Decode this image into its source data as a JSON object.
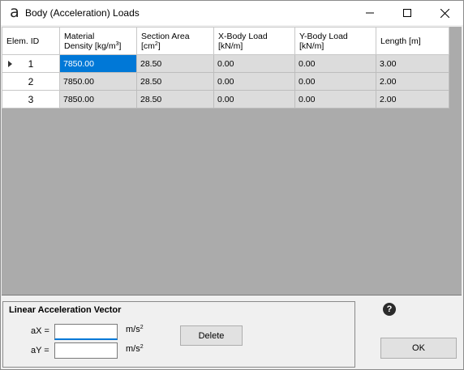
{
  "window": {
    "title": "Body (Acceleration) Loads",
    "icon": "app-logo-icon"
  },
  "grid": {
    "headers": {
      "elem_id": "Elem. ID",
      "density_1": "Material",
      "density_2": "Density [kg/m",
      "density_sup": "3",
      "density_end": "]",
      "area_1": "Section Area",
      "area_2": "[cm",
      "area_sup": "2",
      "area_end": "]",
      "xload_1": "X-Body Load",
      "xload_2": "[kN/m]",
      "yload_1": "Y-Body Load",
      "yload_2": "[kN/m]",
      "length": "Length [m]"
    },
    "rows": [
      {
        "id": "1",
        "density": "7850.00",
        "area": "28.50",
        "xload": "0.00",
        "yload": "0.00",
        "length": "3.00"
      },
      {
        "id": "2",
        "density": "7850.00",
        "area": "28.50",
        "xload": "0.00",
        "yload": "0.00",
        "length": "2.00"
      },
      {
        "id": "3",
        "density": "7850.00",
        "area": "28.50",
        "xload": "0.00",
        "yload": "0.00",
        "length": "2.00"
      }
    ]
  },
  "accel": {
    "title": "Linear Acceleration Vector",
    "ax_label": "aX =",
    "ay_label": "aY =",
    "ax_value": "",
    "ay_value": "",
    "unit": "m/s",
    "unit_sup": "2",
    "delete_label": "Delete"
  },
  "ok_label": "OK",
  "help_label": "?",
  "colors": {
    "selection": "#0078d7",
    "grid_background": "#ababab",
    "cell_background": "#dcdcdc"
  }
}
